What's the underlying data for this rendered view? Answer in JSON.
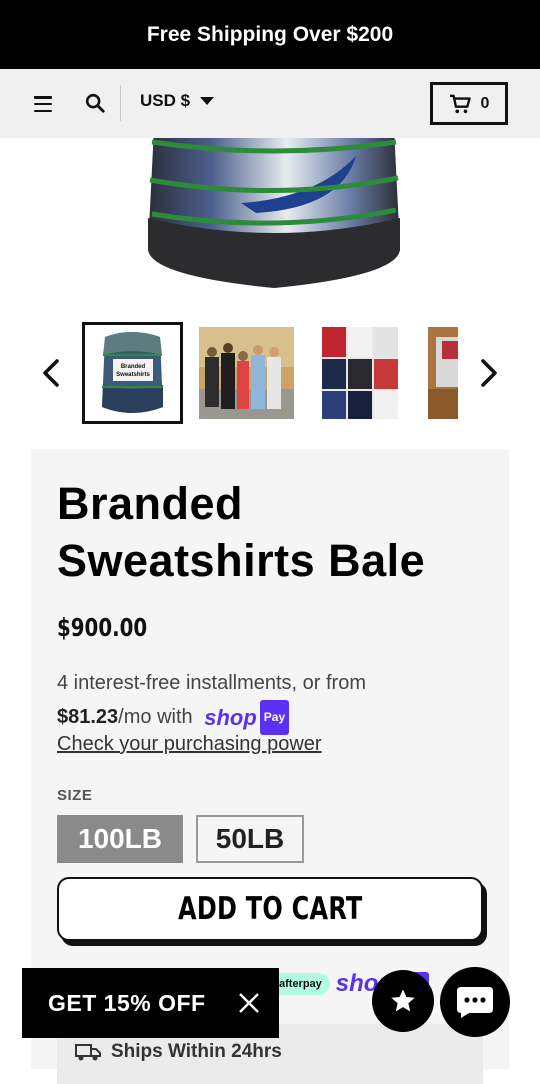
{
  "announcement": "Free Shipping Over $200",
  "header": {
    "currency": "USD $",
    "cart_count": "0"
  },
  "product": {
    "title": "Branded Sweatshirts Bale",
    "price": "$900.00",
    "installments_prefix": "4 interest-free installments, or from",
    "installment_amount": "$81.23",
    "installment_suffix": "/mo with",
    "shop_pay_brand": "shop",
    "shop_pay_badge": "Pay",
    "purchasing_power_link": "Check your purchasing power",
    "size_label": "SIZE",
    "sizes": [
      {
        "label": "100LB",
        "selected": true
      },
      {
        "label": "50LB",
        "selected": false
      }
    ],
    "add_to_cart": "ADD TO CART",
    "afterpay_label": "afterpay",
    "shipping_note": "Ships Within 24hrs"
  },
  "thumbnail_bale_text": "Branded Sweatshirts",
  "promo": {
    "label": "GET 15% OFF"
  },
  "icons": {
    "menu": "hamburger-icon",
    "search": "search-icon",
    "cart": "cart-icon",
    "prev": "chevron-left-icon",
    "next": "chevron-right-icon",
    "close": "close-icon",
    "star": "star-icon",
    "chat": "chat-icon",
    "truck": "truck-icon"
  },
  "colors": {
    "shop_pay": "#5a31f4",
    "afterpay": "#b2fce4",
    "selected_size": "#8a8a8a"
  }
}
